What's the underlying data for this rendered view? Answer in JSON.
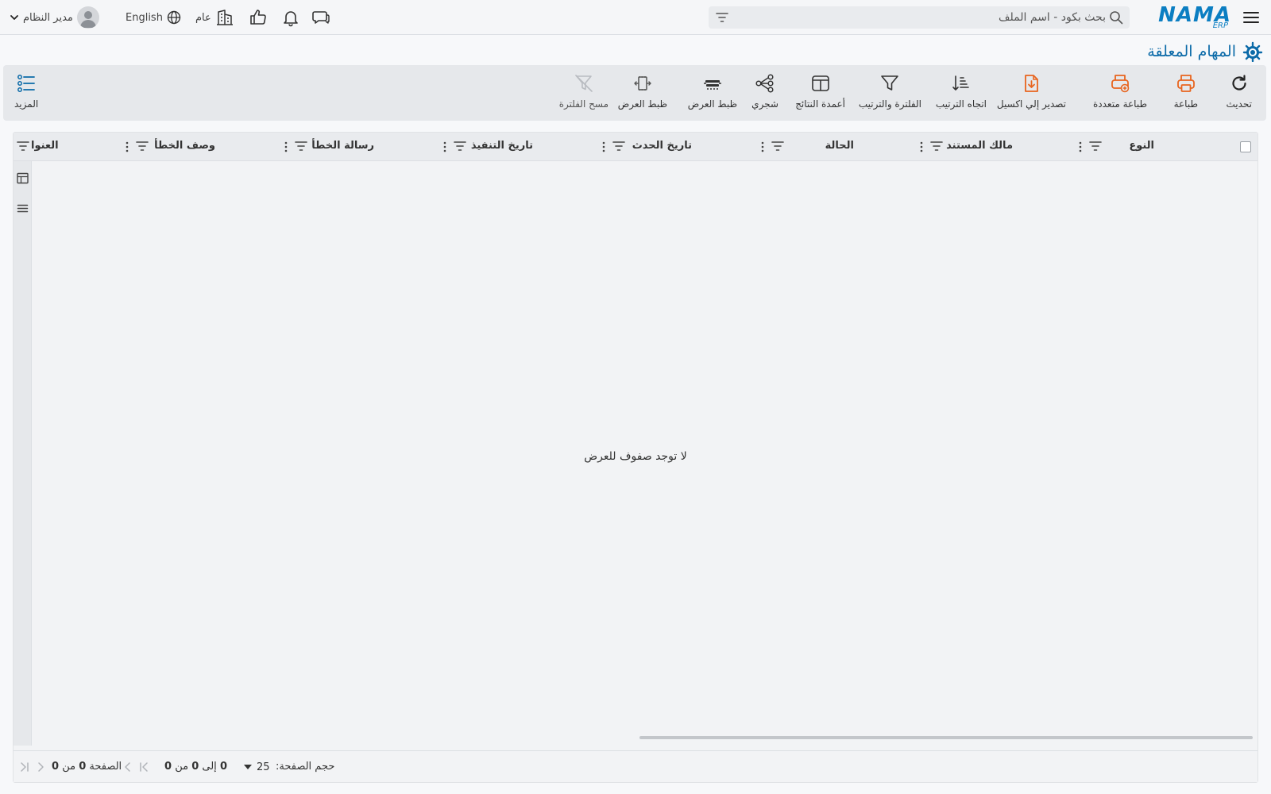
{
  "header": {
    "logo_text": "NAMA",
    "logo_sub": "ERP",
    "search_placeholder": "بحث بكود - اسم الملف",
    "branch_label": "عام",
    "language_label": "English",
    "user_name": "مدير النظام"
  },
  "page": {
    "title": "المهام المعلقة"
  },
  "toolbar": {
    "refresh": "تحديث",
    "print": "طباعة",
    "multi_print": "طباعة متعددة",
    "export_excel": "تصدير إلي اكسيل",
    "sort_direction": "اتجاه الترتيب",
    "filter_sort": "الفلترة والترتيب",
    "result_columns": "أعمدة النتائج",
    "tree": "شجري",
    "fit_width_1": "ظبط العرض",
    "fit_width_2": "ظبط العرض",
    "clear_filter": "مسح الفلترة",
    "more": "المزيد"
  },
  "grid": {
    "columns": [
      "النوع",
      "مالك المستند",
      "الحالة",
      "تاريخ الحدث",
      "تاريخ التنفيذ",
      "رسالة الخطأ",
      "وصف الخطأ",
      "العنوا"
    ],
    "empty_message": "لا توجد صفوف للعرض"
  },
  "footer": {
    "page_size_label": "حجم الصفحة:",
    "page_size_value": "25",
    "range_from": "0",
    "range_to_label": "إلى",
    "range_to": "0",
    "range_of_label": "من",
    "range_total": "0",
    "page_label": "الصفحة",
    "page_current": "0",
    "page_of_label": "من",
    "page_total": "0"
  },
  "colors": {
    "brand": "#0b7ec2",
    "title": "#0b6aa8",
    "orange": "#e8641e"
  }
}
